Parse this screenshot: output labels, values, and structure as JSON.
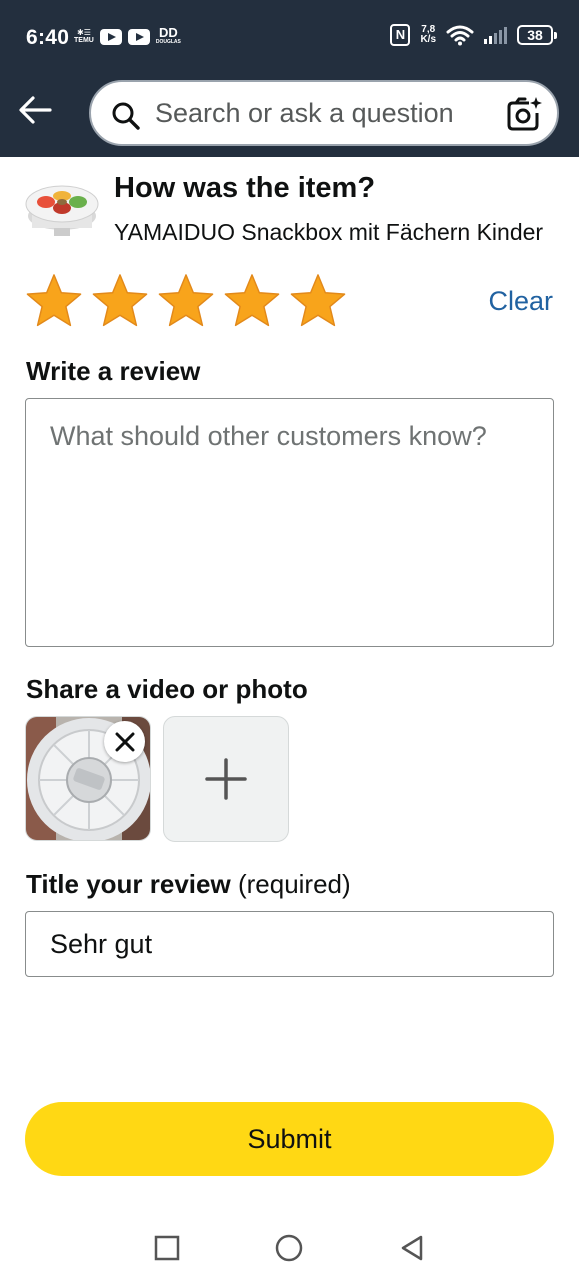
{
  "status_bar": {
    "time": "6:40",
    "left_badges": [
      "TEMU",
      "DOUGLAS"
    ],
    "net_speed_value": "7,8",
    "net_speed_unit": "K/s",
    "battery": "38",
    "icons": [
      "temu-icon",
      "youtube-icon",
      "youtube-icon",
      "douglas-icon",
      "nfc-icon",
      "wifi-icon",
      "signal-icon",
      "battery-icon"
    ]
  },
  "header": {
    "back_icon": "arrow-left-icon",
    "search_placeholder": "Search or ask a question",
    "search_icon": "search-icon",
    "camera_icon": "camera-sparkle-icon"
  },
  "product": {
    "heading": "How was the item?",
    "name": "YAMAIDUO Snackbox mit Fächern Kinder"
  },
  "rating": {
    "stars_filled": 5,
    "stars_total": 5,
    "star_color": "#f8a41b",
    "clear_label": "Clear"
  },
  "review": {
    "label": "Write a review",
    "placeholder": "What should other customers know?",
    "value": ""
  },
  "media": {
    "label": "Share a video or photo",
    "remove_icon": "close-icon",
    "add_icon": "plus-icon"
  },
  "title": {
    "label": "Title your review",
    "label_suffix": "(required)",
    "value": "Sehr gut"
  },
  "submit": {
    "label": "Submit",
    "color": "#ffd814"
  },
  "nav_bar": {
    "icons": [
      "recents-square-icon",
      "home-circle-icon",
      "back-triangle-icon"
    ]
  },
  "colors": {
    "header_bg": "#232f3e",
    "link": "#2162a1"
  }
}
